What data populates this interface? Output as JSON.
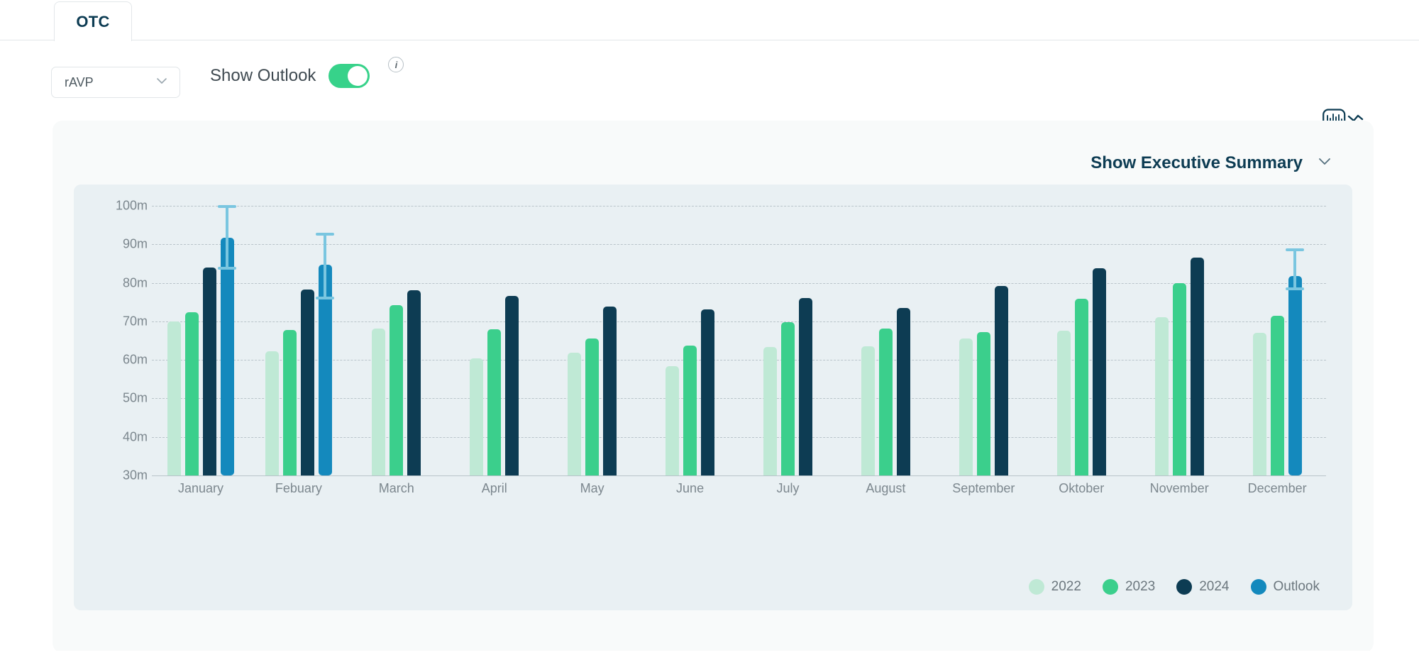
{
  "tab": {
    "label": "OTC"
  },
  "controls": {
    "select": {
      "value": "rAVP",
      "icon": "chevron-down-icon"
    },
    "outlook_toggle": {
      "label": "Show Outlook",
      "state": "on",
      "on_color": "#37d28a"
    },
    "info_icon": "i",
    "view_toggle_icon": "bar-and-wave-chart-icon"
  },
  "card": {
    "exec_summary": {
      "label": "Show Executive Summary",
      "icon": "chevron-down-icon"
    }
  },
  "legend": [
    {
      "label": "2022",
      "color": "#bfe9d5"
    },
    {
      "label": "2023",
      "color": "#3bcf8c"
    },
    {
      "label": "2024",
      "color": "#0d3c53"
    },
    {
      "label": "Outlook",
      "color": "#1489bd"
    }
  ],
  "chart_data": {
    "type": "bar",
    "title": "",
    "xlabel": "",
    "ylabel": "",
    "ylim": [
      30,
      100
    ],
    "ytick_values": [
      30,
      40,
      50,
      60,
      70,
      80,
      90,
      100
    ],
    "ytick_labels": [
      "30m",
      "40m",
      "50m",
      "60m",
      "70m",
      "80m",
      "90m",
      "100m"
    ],
    "grid": true,
    "legend_position": "bottom-right",
    "unit_suffix": "m",
    "categories": [
      "January",
      "Febuary",
      "March",
      "April",
      "May",
      "June",
      "July",
      "August",
      "September",
      "Oktober",
      "November",
      "December"
    ],
    "series": [
      {
        "name": "2022",
        "color": "#bfe9d5",
        "values": [
          70.0,
          62.2,
          68.1,
          60.4,
          61.8,
          58.4,
          63.4,
          63.6,
          65.6,
          67.6,
          71.0,
          67.0
        ]
      },
      {
        "name": "2023",
        "color": "#3bcf8c",
        "values": [
          72.3,
          67.8,
          74.2,
          67.9,
          65.6,
          63.8,
          69.8,
          68.2,
          67.2,
          75.8,
          80.0,
          71.4
        ]
      },
      {
        "name": "2024",
        "color": "#0d3c53",
        "values": [
          84.0,
          78.3,
          78.0,
          76.6,
          73.8,
          73.2,
          76.0,
          73.5,
          79.2,
          83.8,
          86.5,
          null
        ]
      },
      {
        "name": "Outlook",
        "color": "#1489bd",
        "values": [
          91.8,
          84.8,
          null,
          null,
          null,
          null,
          null,
          null,
          null,
          null,
          null,
          81.8
        ],
        "error_low": [
          84.2,
          76.4,
          null,
          null,
          null,
          null,
          null,
          null,
          null,
          null,
          null,
          78.8
        ],
        "error_high": [
          100.2,
          93.0,
          null,
          null,
          null,
          null,
          null,
          null,
          null,
          null,
          null,
          89.0
        ]
      }
    ]
  }
}
